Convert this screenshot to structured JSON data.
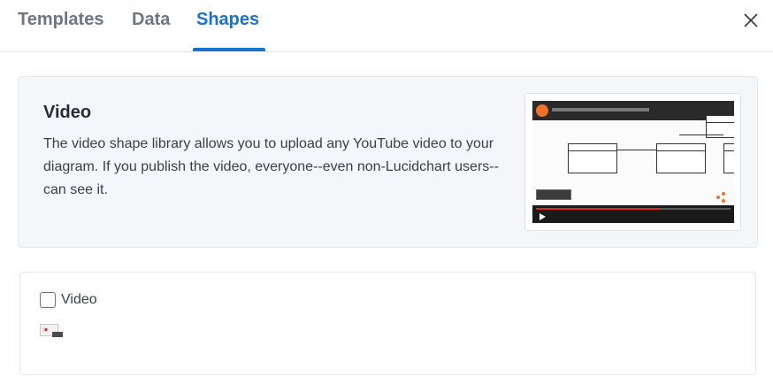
{
  "tabs": [
    {
      "label": "Templates",
      "active": false
    },
    {
      "label": "Data",
      "active": false
    },
    {
      "label": "Shapes",
      "active": true
    }
  ],
  "colors": {
    "accent": "#1a73c8",
    "tab_inactive": "#6f7681",
    "card_bg": "#f4f6f9"
  },
  "close_icon": "close-icon",
  "info": {
    "title": "Video",
    "description": "The video shape library allows you to upload any YouTube video to your diagram. If you publish the video, everyone--even non-Lucidchart users--can see it."
  },
  "library": {
    "checkbox_label": "Video",
    "checked": false,
    "shape_icon": "video-shape-icon"
  }
}
